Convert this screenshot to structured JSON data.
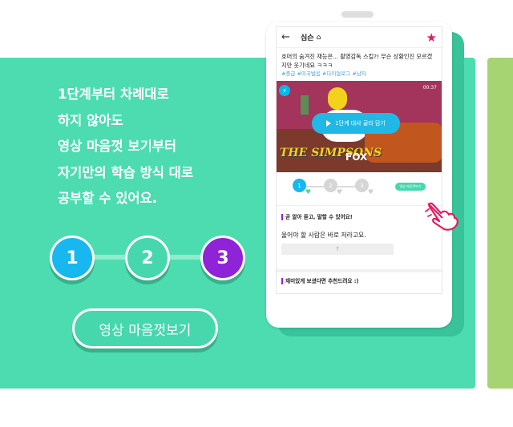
{
  "colors": {
    "teal": "#4cdcb0",
    "green": "#a6d472",
    "step1": "#17b8ef",
    "step2": "#46d7ad",
    "step3": "#8f23d7",
    "favorite": "#e8195c"
  },
  "hero": {
    "lines": [
      "1단계부터 차례대로",
      "하지 않아도",
      "영상 마음껏 보기부터",
      "자기만의 학습 방식 대로",
      "공부할 수 있어요."
    ]
  },
  "steps": [
    "1",
    "2",
    "3"
  ],
  "cta": {
    "label": "영상 마음껏보기"
  },
  "phone": {
    "topbar": {
      "back_icon": "←",
      "title": "심슨",
      "home_icon": "home-icon",
      "favorite_icon": "star-icon"
    },
    "description": "호머의 숨겨진 재능은... 촬영감독 스킬?! 무슨 상황인진 모르겠지만 웃기네요 ㅋㅋㅋ",
    "tags": "#중급 #미국발음 #다이얼로그 #남자",
    "video": {
      "time": "00:37",
      "play_label": "1단계 대사 골라 담기",
      "show_logo": "THE SIMPSONS",
      "network_logo": "FOX"
    },
    "mini_steps": [
      "1",
      "2",
      "3"
    ],
    "mini_button": "영상 마음껏보기",
    "question1": {
      "heading": "곧 알아 듣고, 말할 수 있어요!",
      "text": "울어야 할 사람은 바로 저라고요.",
      "answer_placeholder": "?"
    },
    "question2": {
      "heading": "재미있게 보셨다면 추천드려요 :)"
    }
  }
}
